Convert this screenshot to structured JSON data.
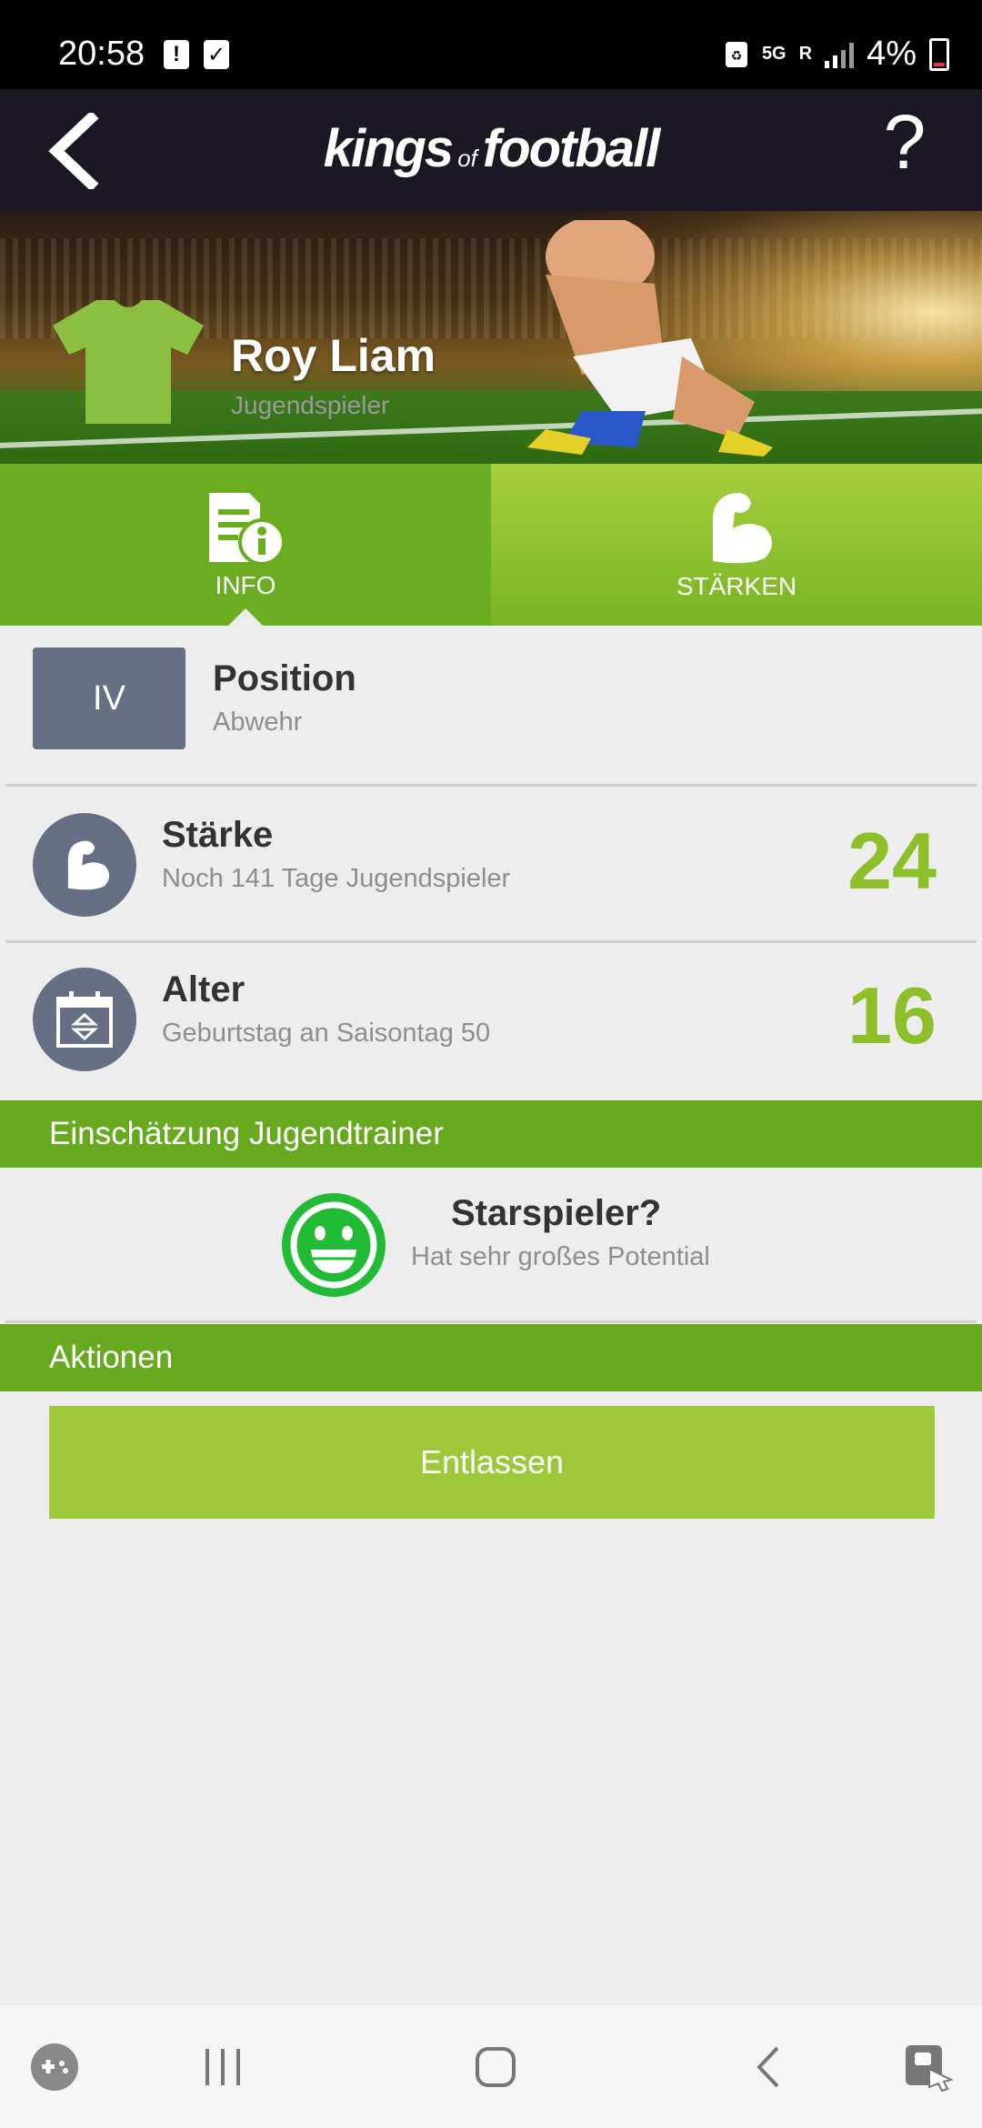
{
  "status_bar": {
    "time": "20:58",
    "network": "5G",
    "roaming": "R",
    "battery": "4%"
  },
  "header": {
    "logo_main_1": "kings",
    "logo_of": "of",
    "logo_main_2": "football",
    "help_label": "?"
  },
  "player": {
    "name": "Roy Liam",
    "role": "Jugendspieler",
    "jersey_color": "#8bbf3f"
  },
  "tabs": [
    {
      "label": "INFO",
      "icon": "document-info-icon",
      "active": true
    },
    {
      "label": "STÄRKEN",
      "icon": "flexed-arm-icon",
      "active": false
    }
  ],
  "position": {
    "badge": "IV",
    "title": "Position",
    "value": "Abwehr"
  },
  "strength": {
    "title": "Stärke",
    "subtitle": "Noch 141 Tage Jugendspieler",
    "value": "24",
    "icon": "flexed-arm-icon"
  },
  "age": {
    "title": "Alter",
    "subtitle": "Geburtstag an Saisontag 50",
    "value": "16",
    "icon": "calendar-icon"
  },
  "assessment": {
    "section_title": "Einschätzung Jugendtrainer",
    "title": "Starspieler?",
    "subtitle": "Hat sehr großes Potential",
    "icon": "smiley-icon"
  },
  "actions": {
    "section_title": "Aktionen",
    "dismiss_label": "Entlassen"
  },
  "colors": {
    "header_bg": "#1b1724",
    "accent_green": "#67a91f",
    "value_green": "#8cbf2a",
    "badge_gray": "#666f84",
    "button_green": "#9cc83a"
  }
}
